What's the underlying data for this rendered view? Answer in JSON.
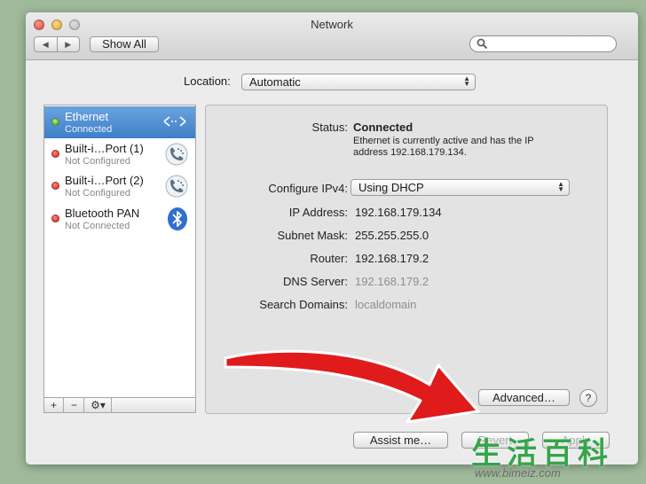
{
  "window": {
    "title": "Network"
  },
  "toolbar": {
    "back_label": "◀",
    "forward_label": "▶",
    "show_all_label": "Show All",
    "search_placeholder": ""
  },
  "location": {
    "label": "Location:",
    "value": "Automatic"
  },
  "services": [
    {
      "name": "Ethernet",
      "status": "Connected",
      "state": "green",
      "icon": "ethernet-icon",
      "selected": true
    },
    {
      "name": "Built-i…Port (1)",
      "status": "Not Configured",
      "state": "red",
      "icon": "phone-modem-icon",
      "selected": false
    },
    {
      "name": "Built-i…Port (2)",
      "status": "Not Configured",
      "state": "red",
      "icon": "phone-modem-icon",
      "selected": false
    },
    {
      "name": "Bluetooth PAN",
      "status": "Not Connected",
      "state": "red",
      "icon": "bluetooth-icon",
      "selected": false
    }
  ],
  "sidebar_tools": {
    "add": "+",
    "remove": "−",
    "action": "⚙▾"
  },
  "detail": {
    "status_label": "Status:",
    "status_value": "Connected",
    "status_desc": "Ethernet is currently active and has the IP address 192.168.179.134.",
    "configure_label": "Configure IPv4:",
    "configure_value": "Using DHCP",
    "ip_label": "IP Address:",
    "ip_value": "192.168.179.134",
    "subnet_label": "Subnet Mask:",
    "subnet_value": "255.255.255.0",
    "router_label": "Router:",
    "router_value": "192.168.179.2",
    "dns_label": "DNS Server:",
    "dns_value": "192.168.179.2",
    "search_domains_label": "Search Domains:",
    "search_domains_value": "localdomain",
    "advanced_label": "Advanced…",
    "help_label": "?"
  },
  "footer": {
    "assist_label": "Assist me…",
    "revert_label": "Revert",
    "apply_label": "Apply"
  },
  "watermark": {
    "chars": "生活百科",
    "url": "www.bimeiz.com"
  },
  "colors": {
    "selection": "#3f7fc8",
    "arrow": "#e01b1b",
    "connected": "#38a51c",
    "disconnected": "#cc1d12"
  }
}
